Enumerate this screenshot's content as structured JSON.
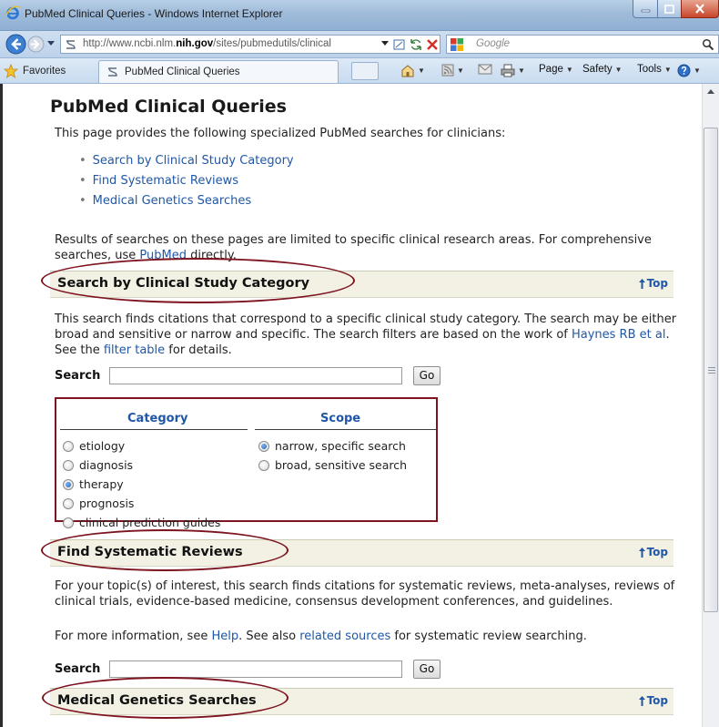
{
  "window": {
    "title": "PubMed Clinical Queries - Windows Internet Explorer",
    "controls": {
      "minimize": "minimize",
      "maximize": "maximize",
      "close": "close"
    }
  },
  "address": {
    "url_prefix": "http://www.ncbi.nlm.",
    "url_domain": "nih.gov",
    "url_suffix": "/sites/pubmedutils/clinical",
    "search_placeholder": "Google"
  },
  "favorites_bar": {
    "favorites_label": "Favorites",
    "tab_title": "PubMed Clinical Queries",
    "commands": [
      "Page",
      "Safety",
      "Tools"
    ]
  },
  "page": {
    "title": "PubMed Clinical Queries",
    "intro": "This page provides the following specialized PubMed searches for clinicians:",
    "toc": [
      "Search by Clinical Study Category",
      "Find Systematic Reviews",
      "Medical Genetics Searches"
    ],
    "results_note_a": "Results of searches on these pages are limited to specific clinical research areas. For comprehensive searches, use ",
    "results_note_link": "PubMed",
    "results_note_b": " directly.",
    "top_label": "Top",
    "search_label": "Search",
    "go_label": "Go"
  },
  "section1": {
    "title": "Search by Clinical Study Category",
    "desc_a": "This search finds citations that correspond to a specific clinical study category. The search may be either broad and sensitive or narrow and specific. The search filters are based on the work of ",
    "desc_link1": "Haynes RB et al",
    "desc_b": ". See the ",
    "desc_link2": "filter table",
    "desc_c": " for details.",
    "search_value": "",
    "category_header": "Category",
    "scope_header": "Scope",
    "categories": [
      {
        "label": "etiology",
        "selected": false
      },
      {
        "label": "diagnosis",
        "selected": false
      },
      {
        "label": "therapy",
        "selected": true
      },
      {
        "label": "prognosis",
        "selected": false
      },
      {
        "label": "clinical prediction guides",
        "selected": false
      }
    ],
    "scopes": [
      {
        "label": "narrow, specific search",
        "selected": true
      },
      {
        "label": "broad, sensitive search",
        "selected": false
      }
    ]
  },
  "section2": {
    "title": "Find Systematic Reviews",
    "desc": "For your topic(s) of interest, this search finds citations for systematic reviews, meta-analyses, reviews of clinical trials, evidence-based medicine, consensus development conferences, and guidelines.",
    "more_a": "For more information, see ",
    "more_link1": "Help",
    "more_b": ". See also ",
    "more_link2": "related sources",
    "more_c": " for systematic review searching.",
    "search_value": ""
  },
  "section3": {
    "title": "Medical Genetics Searches"
  },
  "colors": {
    "link": "#1f57a6",
    "section_bar": "#f2f1e4",
    "annotation": "#7d1420"
  }
}
